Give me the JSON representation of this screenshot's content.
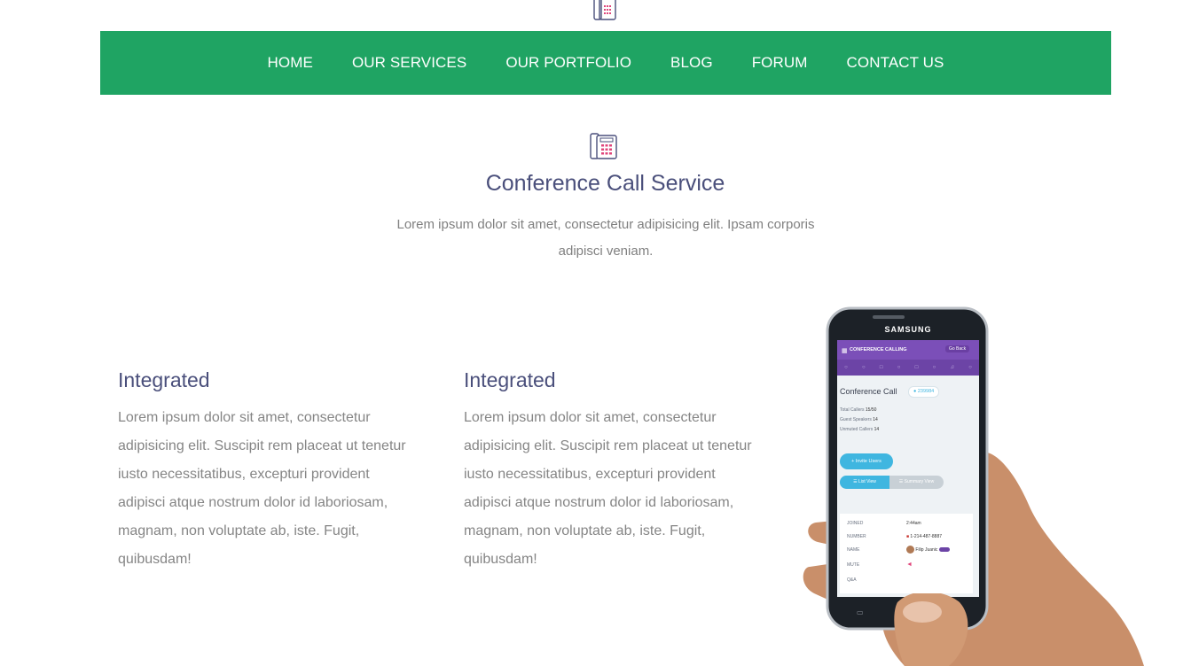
{
  "nav": {
    "items": [
      {
        "label": "HOME"
      },
      {
        "label": "OUR SERVICES"
      },
      {
        "label": "OUR PORTFOLIO"
      },
      {
        "label": "BLOG"
      },
      {
        "label": "FORUM"
      },
      {
        "label": "CONTACT US"
      }
    ]
  },
  "service": {
    "icon": "desk-phone-icon",
    "title": "Conference Call Service",
    "description": "Lorem ipsum dolor sit amet, consectetur adipisicing elit. Ipsam corporis adipisci veniam."
  },
  "features": [
    {
      "title": "Integrated",
      "text": "Lorem ipsum dolor sit amet, consectetur adipisicing elit. Suscipit rem placeat ut tenetur iusto necessitatibus, excepturi provident adipisci atque nostrum dolor id laboriosam, magnam, non voluptate ab, iste. Fugit, quibusdam!"
    },
    {
      "title": "Integrated",
      "text": "Lorem ipsum dolor sit amet, consectetur adipisicing elit. Suscipit rem placeat ut tenetur iusto necessitatibus, excepturi provident adipisci atque nostrum dolor id laboriosam, magnam, non voluptate ab, iste. Fugit, quibusdam!"
    }
  ],
  "phone": {
    "brand": "SAMSUNG",
    "app_header": "CONFERENCE CALLING",
    "go_back": "Go Back",
    "screen_title": "Conference Call",
    "badge": "239984",
    "stats": [
      {
        "label": "Total Callers",
        "value": "15/50"
      },
      {
        "label": "Guest Speakers",
        "value": "14"
      },
      {
        "label": "Unmuted Callers",
        "value": "14"
      }
    ],
    "invite_button": "Invite Users",
    "tabs": [
      "List View",
      "Summary View"
    ],
    "details": [
      {
        "label": "JOINED",
        "value": "2:44am"
      },
      {
        "label": "NUMBER",
        "value": "1-214-487-8887"
      },
      {
        "label": "NAME",
        "value": "Filip Juanic"
      },
      {
        "label": "MUTE",
        "value": ""
      },
      {
        "label": "Q&A",
        "value": ""
      }
    ]
  },
  "colors": {
    "nav_bg": "#1fa463",
    "heading": "#4a4f7b",
    "body_text": "#858585",
    "app_purple": "#7b4fb8",
    "app_blue": "#3fb6e0",
    "icon_pink": "#e0457b"
  }
}
